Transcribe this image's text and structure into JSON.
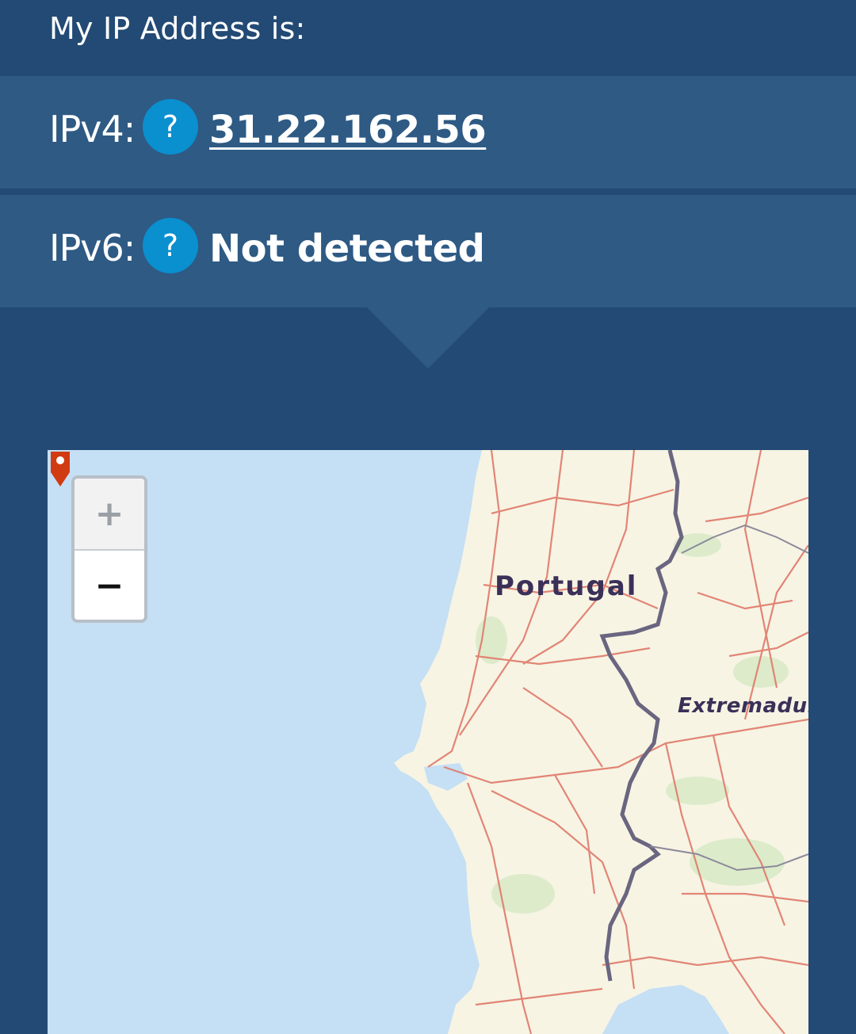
{
  "header": {
    "title": "My IP Address is:"
  },
  "ipv4": {
    "label": "IPv4:",
    "help": "?",
    "value": "31.22.162.56"
  },
  "ipv6": {
    "label": "IPv6:",
    "help": "?",
    "value": "Not detected"
  },
  "map": {
    "zoom_in": "+",
    "zoom_out": "−",
    "labels": {
      "country": "Portugal",
      "region": "Extremadur"
    },
    "marker_icon": "map-pin-icon"
  },
  "colors": {
    "background": "#224a74",
    "row": "#2e5a84",
    "help_button": "#0a8fcf",
    "sea": "#c5dff4",
    "land": "#f7f4e4",
    "road": "#e07a6a",
    "border": "#6a6680",
    "marker": "#d13b12"
  }
}
